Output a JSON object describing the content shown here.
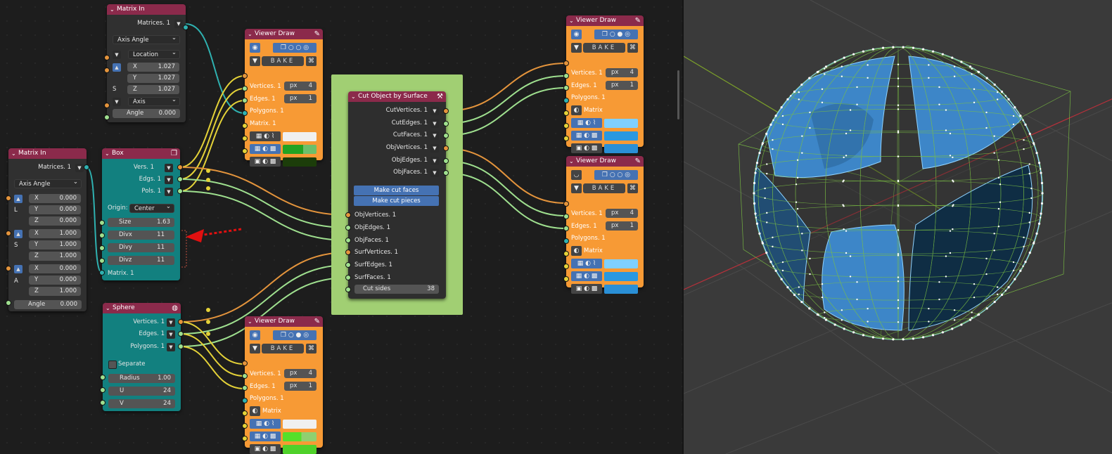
{
  "matrix_in_top": {
    "title": "Matrix In",
    "matrices": "Matrices. 1",
    "mode": "Axis Angle",
    "location": "Location",
    "x": "X",
    "y": "Y",
    "z": "Z",
    "sx": "1.027",
    "sy": "1.027",
    "sz": "1.027",
    "s": "S",
    "axis": "Axis",
    "angle_label": "Angle",
    "angle": "0.000"
  },
  "matrix_in_left": {
    "title": "Matrix In",
    "matrices": "Matrices. 1",
    "mode": "Axis Angle",
    "l": "L",
    "s": "S",
    "a": "A",
    "x": "X",
    "y": "Y",
    "z": "Z",
    "lx": "0.000",
    "ly": "0.000",
    "lz": "0.000",
    "sx": "1.000",
    "sy": "1.000",
    "sz": "1.000",
    "ax": "0.000",
    "ay": "0.000",
    "az": "1.000",
    "angle_label": "Angle",
    "angle": "0.000",
    "matrix_out": "Matrix. 1"
  },
  "box": {
    "title": "Box",
    "vers": "Vers. 1",
    "edgs": "Edgs. 1",
    "pols": "Pols. 1",
    "origin_label": "Origin:",
    "origin": "Center",
    "size_label": "Size",
    "size": "1.63",
    "divx_label": "Divx",
    "divx": "11",
    "divy_label": "Divy",
    "divy": "11",
    "divz_label": "Divz",
    "divz": "11",
    "matrix": "Matrix. 1"
  },
  "sphere": {
    "title": "Sphere",
    "vertices": "Vertices. 1",
    "edges": "Edges. 1",
    "polygons": "Polygons. 1",
    "separate": "Separate",
    "radius_label": "Radius",
    "radius": "1.00",
    "u_label": "U",
    "u": "24",
    "v_label": "V",
    "v": "24"
  },
  "viewer_draw": {
    "title": "Viewer Draw",
    "bake": "BAKE",
    "vertices": "Vertices. 1",
    "edges": "Edges. 1",
    "polygons": "Polygons. 1",
    "matrix": "Matrix. 1",
    "matrix_short": "Matrix",
    "px": "px",
    "v4": "4",
    "v1": "1"
  },
  "cut": {
    "title": "Cut Object by Surface",
    "cut_vertices": "CutVertices. 1",
    "cut_edges": "CutEdges. 1",
    "cut_faces": "CutFaces. 1",
    "obj_vertices_out": "ObjVertices. 1",
    "obj_edges_out": "ObjEdges. 1",
    "obj_faces_out": "ObjFaces. 1",
    "make_cut_faces": "Make cut faces",
    "make_cut_pieces": "Make cut pieces",
    "obj_vertices": "ObjVertices. 1",
    "obj_edges": "ObjEdges. 1",
    "obj_faces": "ObjFaces. 1",
    "surf_vertices": "SurfVertices. 1",
    "surf_edges": "SurfEdges. 1",
    "surf_faces": "SurfFaces. 1",
    "cut_sides_label": "Cut sides",
    "cut_sides": "38"
  },
  "colors": {
    "node_header": "#8b2a4b",
    "viewer_body": "#f79a35",
    "generator_body": "#12807f",
    "frame": "#a1cf73",
    "wire_teal": "#2fb1b0",
    "wire_green": "#9fe08f",
    "wire_orange": "#e4943c",
    "wire_yellow": "#e4d238",
    "face_blue": "#3d86c8",
    "wire_mesh": "#7bc043"
  },
  "icons": [
    "chevron-down-icon",
    "pencil-icon",
    "eye-icon",
    "box-icon",
    "circle-icon",
    "sphere-icon",
    "triangle-down-icon",
    "bake-icon",
    "arrow-up-icon",
    "arrow-down-icon",
    "red-arrow-annotation"
  ]
}
